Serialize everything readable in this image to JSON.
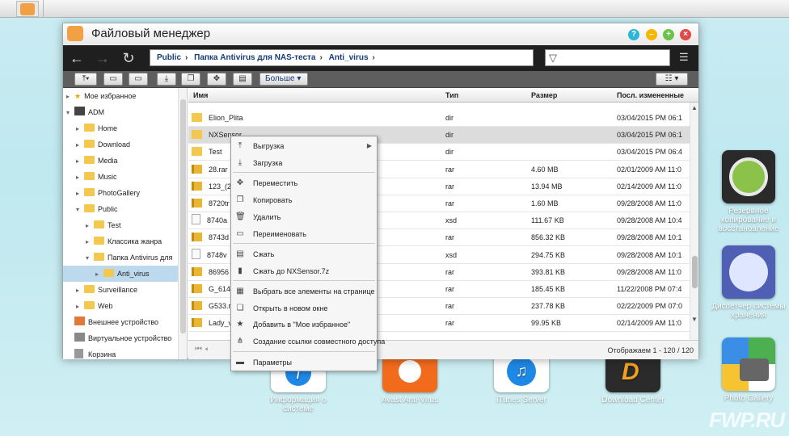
{
  "window": {
    "title": "Файловый менеджер"
  },
  "breadcrumb": [
    "Public",
    "Папка Antivirus для NAS-теста",
    "Anti_virus"
  ],
  "toolbar": {
    "more_label": "Больше"
  },
  "tree": [
    {
      "label": "Мое избранное",
      "icon": "star-icon"
    },
    {
      "label": "ADM",
      "icon": "server-icon"
    },
    {
      "label": "Home"
    },
    {
      "label": "Download"
    },
    {
      "label": "Media"
    },
    {
      "label": "Music"
    },
    {
      "label": "PhotoGallery"
    },
    {
      "label": "Public"
    },
    {
      "label": "Test"
    },
    {
      "label": "Классика жанра"
    },
    {
      "label": "Папка Antivirus для"
    },
    {
      "label": "Anti_virus"
    },
    {
      "label": "Surveillance"
    },
    {
      "label": "Web"
    },
    {
      "label": "Внешнее устройство",
      "icon": "usb-icon"
    },
    {
      "label": "Виртуальное устройство",
      "icon": "virtual-drive-icon"
    },
    {
      "label": "Корзина",
      "icon": "trash-icon"
    }
  ],
  "columns": {
    "name": "Имя",
    "type": "Тип",
    "size": "Размер",
    "modified": "Посл. измененные"
  },
  "files": [
    {
      "name": "Elion_Plita",
      "type": "dir",
      "size": "",
      "date": "03/04/2015 PM 06:1",
      "kind": "fold"
    },
    {
      "name": "NXSensor",
      "type": "dir",
      "size": "",
      "date": "03/04/2015 PM 06:1",
      "kind": "fold"
    },
    {
      "name": "Test",
      "type": "dir",
      "size": "",
      "date": "03/04/2015 PM 06:4",
      "kind": "fold"
    },
    {
      "name": "28.rar",
      "type": "rar",
      "size": "4.60 MB",
      "date": "02/01/2009 AM 11:0",
      "kind": "zip"
    },
    {
      "name": "123_(2",
      "type": "rar",
      "size": "13.94 MB",
      "date": "02/14/2009 AM 11:0",
      "kind": "zip"
    },
    {
      "name": "8720tr",
      "type": "rar",
      "size": "1.60 MB",
      "date": "09/28/2008 AM 11:0",
      "kind": "zip"
    },
    {
      "name": "8740a",
      "type": "xsd",
      "size": "111.67 KB",
      "date": "09/28/2008 AM 10:4",
      "kind": "doc"
    },
    {
      "name": "8743d",
      "type": "rar",
      "size": "856.32 KB",
      "date": "09/28/2008 AM 10:1",
      "kind": "zip"
    },
    {
      "name": "8748v",
      "type": "xsd",
      "size": "294.75 KB",
      "date": "09/28/2008 AM 10:1",
      "kind": "doc"
    },
    {
      "name": "86956",
      "type": "rar",
      "size": "393.81 KB",
      "date": "09/28/2008 AM 11:0",
      "kind": "zip"
    },
    {
      "name": "G_614",
      "type": "rar",
      "size": "185.45 KB",
      "date": "11/22/2008 PM 07:4",
      "kind": "zip"
    },
    {
      "name": "G533.r",
      "type": "rar",
      "size": "237.78 KB",
      "date": "02/22/2009 PM 07:0",
      "kind": "zip"
    },
    {
      "name": "Lady_v",
      "type": "rar",
      "size": "99.95 KB",
      "date": "02/14/2009 AM 11:0",
      "kind": "zip"
    }
  ],
  "status": {
    "count": "Отображаем 1 - 120 / 120"
  },
  "context_menu": [
    {
      "label": "Выгрузка",
      "icon": "upload-icon",
      "submenu": true
    },
    {
      "label": "Загрузка",
      "icon": "download-icon"
    },
    {
      "label": "Переместить",
      "icon": "move-icon"
    },
    {
      "label": "Копировать",
      "icon": "copy-icon"
    },
    {
      "label": "Удалить",
      "icon": "delete-icon"
    },
    {
      "label": "Переименовать",
      "icon": "rename-icon"
    },
    {
      "label": "Сжать",
      "icon": "compress-icon"
    },
    {
      "label": "Сжать до NXSensor.7z",
      "icon": "archive-icon"
    },
    {
      "label": "Выбрать все элементы на странице",
      "icon": "select-all-icon"
    },
    {
      "label": "Открыть в новом окне",
      "icon": "new-window-icon"
    },
    {
      "label": "Добавить в \"Мое избранное\"",
      "icon": "star-icon"
    },
    {
      "label": "Создание ссылки совместного доступа",
      "icon": "share-icon"
    },
    {
      "label": "Параметры",
      "icon": "properties-icon"
    }
  ],
  "desktop_icons": [
    {
      "label": "Резервное копирование и восстановление"
    },
    {
      "label": "Диспетчер системы хранения"
    },
    {
      "label": "Photo Gallery"
    },
    {
      "label": "Информация о системе"
    },
    {
      "label": "Avast Anti-Virus"
    },
    {
      "label": "iTunes Server"
    },
    {
      "label": "Download Center"
    }
  ],
  "watermark": "FWP.RU"
}
